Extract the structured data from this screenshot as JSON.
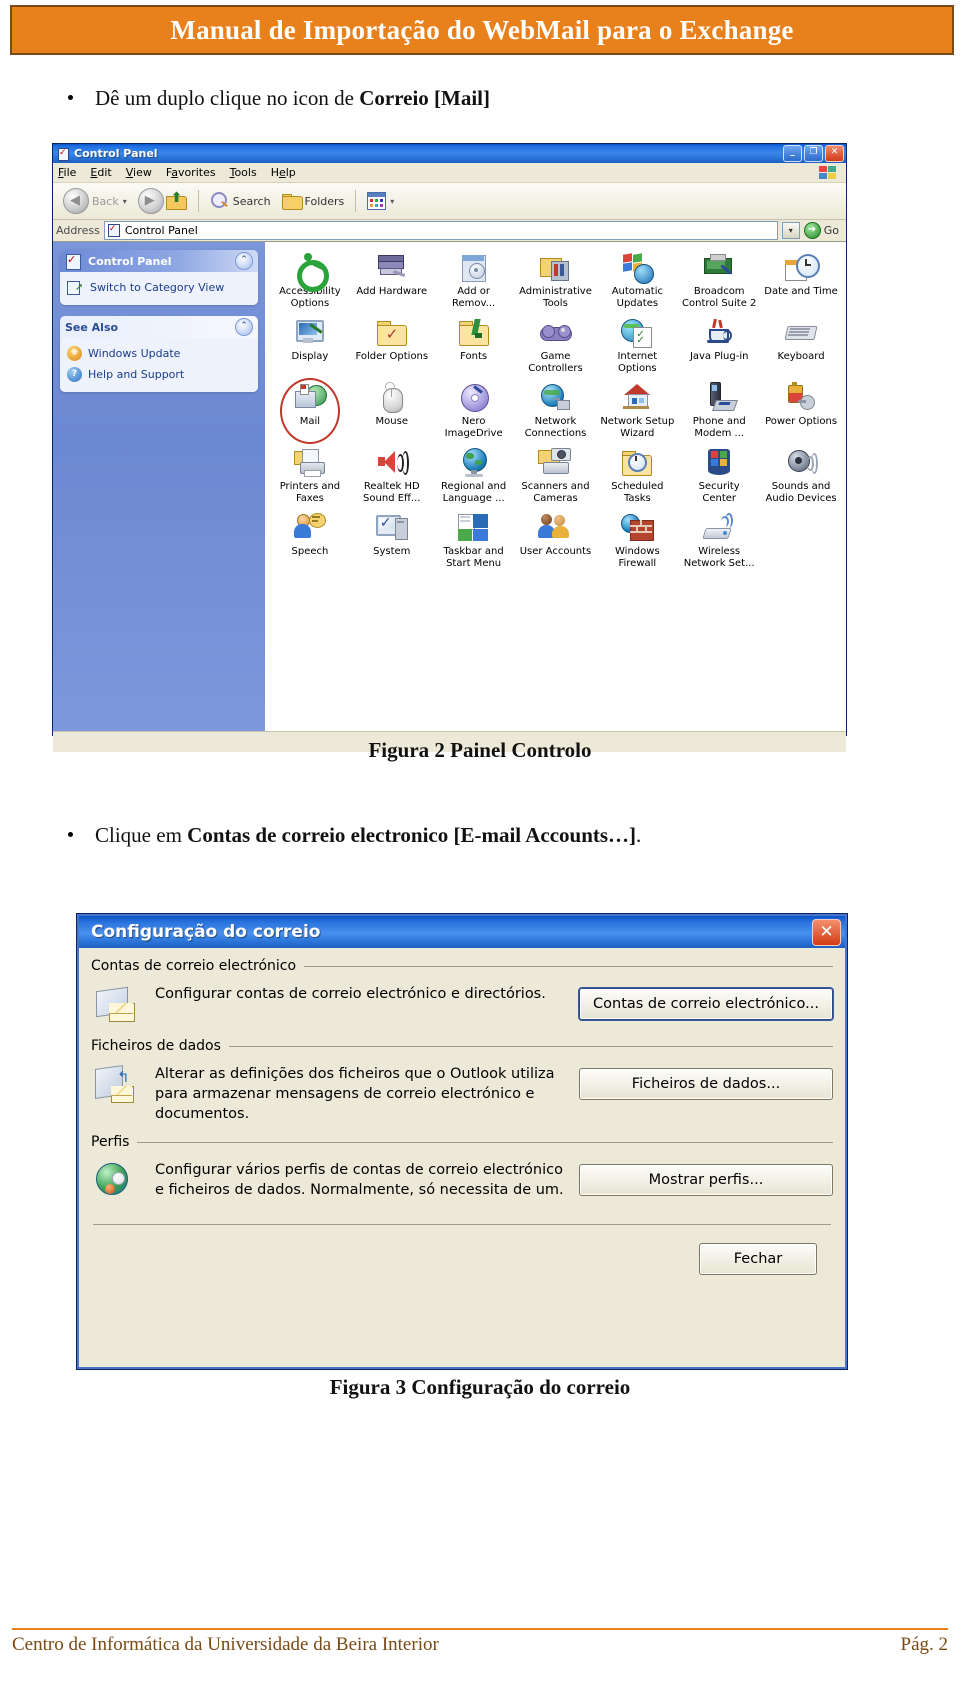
{
  "header": {
    "title": "Manual de Importação do WebMail para o Exchange"
  },
  "bullets": [
    {
      "prefix": "Dê um duplo clique no icon de ",
      "bold": "Correio [Mail]",
      "suffix": ""
    },
    {
      "prefix": "Clique em ",
      "bold": "Contas de correio electronico [E-mail Accounts…]",
      "suffix": "."
    }
  ],
  "captions": {
    "figure2": "Figura 2 Painel Controlo",
    "figure3": "Figura 3 Configuração do correio"
  },
  "control_panel": {
    "window_title": "Control Panel",
    "title_icon": "control-panel-icon",
    "window_buttons": [
      {
        "name": "minimize-button",
        "glyph": "_"
      },
      {
        "name": "maximize-button",
        "glyph": "❐"
      },
      {
        "name": "close-button",
        "glyph": "✕"
      }
    ],
    "menus": [
      "File",
      "Edit",
      "View",
      "Favorites",
      "Tools",
      "Help"
    ],
    "toolbar": {
      "back": "Back",
      "forward": "",
      "up": "",
      "search": "Search",
      "folders": "Folders",
      "views": ""
    },
    "address": {
      "label": "Address",
      "value": "Control Panel",
      "go": "Go"
    },
    "sidebar": {
      "panels": [
        {
          "title": "Control Panel",
          "icon": "control-panel-icon",
          "items": [
            {
              "label": "Switch to Category View",
              "icon": "switch-view-icon"
            }
          ]
        },
        {
          "title": "See Also",
          "icon": "",
          "items": [
            {
              "label": "Windows Update",
              "icon": "windows-update-icon"
            },
            {
              "label": "Help and Support",
              "icon": "help-support-icon"
            }
          ]
        }
      ]
    },
    "items": [
      {
        "label": "Accessibility Options",
        "icon": "accessibility-icon"
      },
      {
        "label": "Add Hardware",
        "icon": "add-hardware-icon"
      },
      {
        "label": "Add or Remov...",
        "icon": "add-remove-programs-icon"
      },
      {
        "label": "Administrative Tools",
        "icon": "administrative-tools-icon"
      },
      {
        "label": "Automatic Updates",
        "icon": "automatic-updates-icon"
      },
      {
        "label": "Broadcom Control Suite 2",
        "icon": "broadcom-icon"
      },
      {
        "label": "Date and Time",
        "icon": "date-time-icon"
      },
      {
        "label": "Display",
        "icon": "display-icon"
      },
      {
        "label": "Folder Options",
        "icon": "folder-options-icon"
      },
      {
        "label": "Fonts",
        "icon": "fonts-icon"
      },
      {
        "label": "Game Controllers",
        "icon": "game-controllers-icon"
      },
      {
        "label": "Internet Options",
        "icon": "internet-options-icon"
      },
      {
        "label": "Java Plug-in",
        "icon": "java-icon"
      },
      {
        "label": "Keyboard",
        "icon": "keyboard-icon"
      },
      {
        "label": "Mail",
        "icon": "mail-icon"
      },
      {
        "label": "Mouse",
        "icon": "mouse-icon"
      },
      {
        "label": "Nero ImageDrive",
        "icon": "nero-imagedrive-icon"
      },
      {
        "label": "Network Connections",
        "icon": "network-connections-icon"
      },
      {
        "label": "Network Setup Wizard",
        "icon": "network-setup-icon"
      },
      {
        "label": "Phone and Modem ...",
        "icon": "phone-modem-icon"
      },
      {
        "label": "Power Options",
        "icon": "power-options-icon"
      },
      {
        "label": "Printers and Faxes",
        "icon": "printers-faxes-icon"
      },
      {
        "label": "Realtek HD Sound Eff...",
        "icon": "realtek-sound-icon"
      },
      {
        "label": "Regional and Language ...",
        "icon": "regional-language-icon"
      },
      {
        "label": "Scanners and Cameras",
        "icon": "scanners-cameras-icon"
      },
      {
        "label": "Scheduled Tasks",
        "icon": "scheduled-tasks-icon"
      },
      {
        "label": "Security Center",
        "icon": "security-center-icon"
      },
      {
        "label": "Sounds and Audio Devices",
        "icon": "sounds-audio-icon"
      },
      {
        "label": "Speech",
        "icon": "speech-icon"
      },
      {
        "label": "System",
        "icon": "system-icon"
      },
      {
        "label": "Taskbar and Start Menu",
        "icon": "taskbar-start-icon"
      },
      {
        "label": "User Accounts",
        "icon": "user-accounts-icon"
      },
      {
        "label": "Windows Firewall",
        "icon": "windows-firewall-icon"
      },
      {
        "label": "Wireless Network Set...",
        "icon": "wireless-network-icon"
      }
    ],
    "highlighted_item": "Mail"
  },
  "mail_setup_dialog": {
    "title": "Configuração do correio",
    "close_label": "✕",
    "groups": [
      {
        "legend": "Contas de correio electrónico",
        "icon": "email-accounts-icon",
        "description": "Configurar contas de correio electrónico e directórios.",
        "button": "Contas de correio electrónico..."
      },
      {
        "legend": "Ficheiros de dados",
        "icon": "data-files-icon",
        "description": "Alterar as definições dos ficheiros que o Outlook utiliza para armazenar mensagens de correio electrónico e documentos.",
        "button": "Ficheiros de dados..."
      },
      {
        "legend": "Perfis",
        "icon": "profiles-icon",
        "description": "Configurar vários perfis de contas de correio electrónico e ficheiros de dados. Normalmente, só necessita de um.",
        "button": "Mostrar perfis..."
      }
    ],
    "close_button": "Fechar"
  },
  "footer": {
    "left": "Centro de Informática da Universidade da Beira Interior",
    "right": "Pág. 2"
  },
  "colors": {
    "accent": "#E8801C",
    "title_bar_blue": "#2a74dd",
    "sidebar_blue": "#6b88d2",
    "highlight_ring": "#c0392b"
  }
}
